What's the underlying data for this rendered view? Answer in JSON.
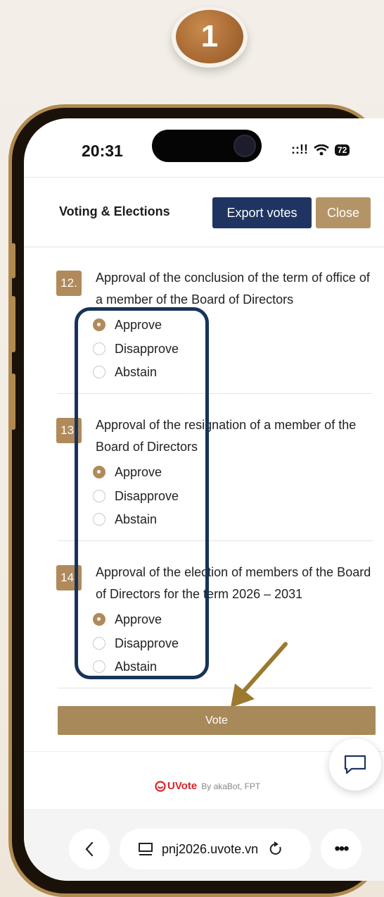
{
  "step": {
    "number": "1"
  },
  "status_bar": {
    "time": "20:31",
    "signal": "::!!",
    "wifi_icon": "wifi-icon",
    "battery": "72"
  },
  "header": {
    "title": "Voting & Elections",
    "export_label": "Export votes",
    "close_label": "Close"
  },
  "questions": [
    {
      "number": "12.",
      "text": "Approval of the conclusion of the term of office of a member of the Board of Directors",
      "options": [
        "Approve",
        "Disapprove",
        "Abstain"
      ],
      "selected": "Approve"
    },
    {
      "number": "13.",
      "text": "Approval of the resignation of a member of the Board of Directors",
      "options": [
        "Approve",
        "Disapprove",
        "Abstain"
      ],
      "selected": "Approve"
    },
    {
      "number": "14.",
      "text": "Approval of the election of members of the Board of Directors for the term 2026 – 2031",
      "options": [
        "Approve",
        "Disapprove",
        "Abstain"
      ],
      "selected": "Approve"
    }
  ],
  "vote_label": "Vote",
  "footer": {
    "brand": "UVote",
    "byline": "By akaBot, FPT"
  },
  "browser": {
    "url": "pnj2026.uvote.vn",
    "more": "•••"
  },
  "colors": {
    "accent_gold": "#b08a5b",
    "navy": "#1f3461",
    "highlight_border": "#173357"
  }
}
